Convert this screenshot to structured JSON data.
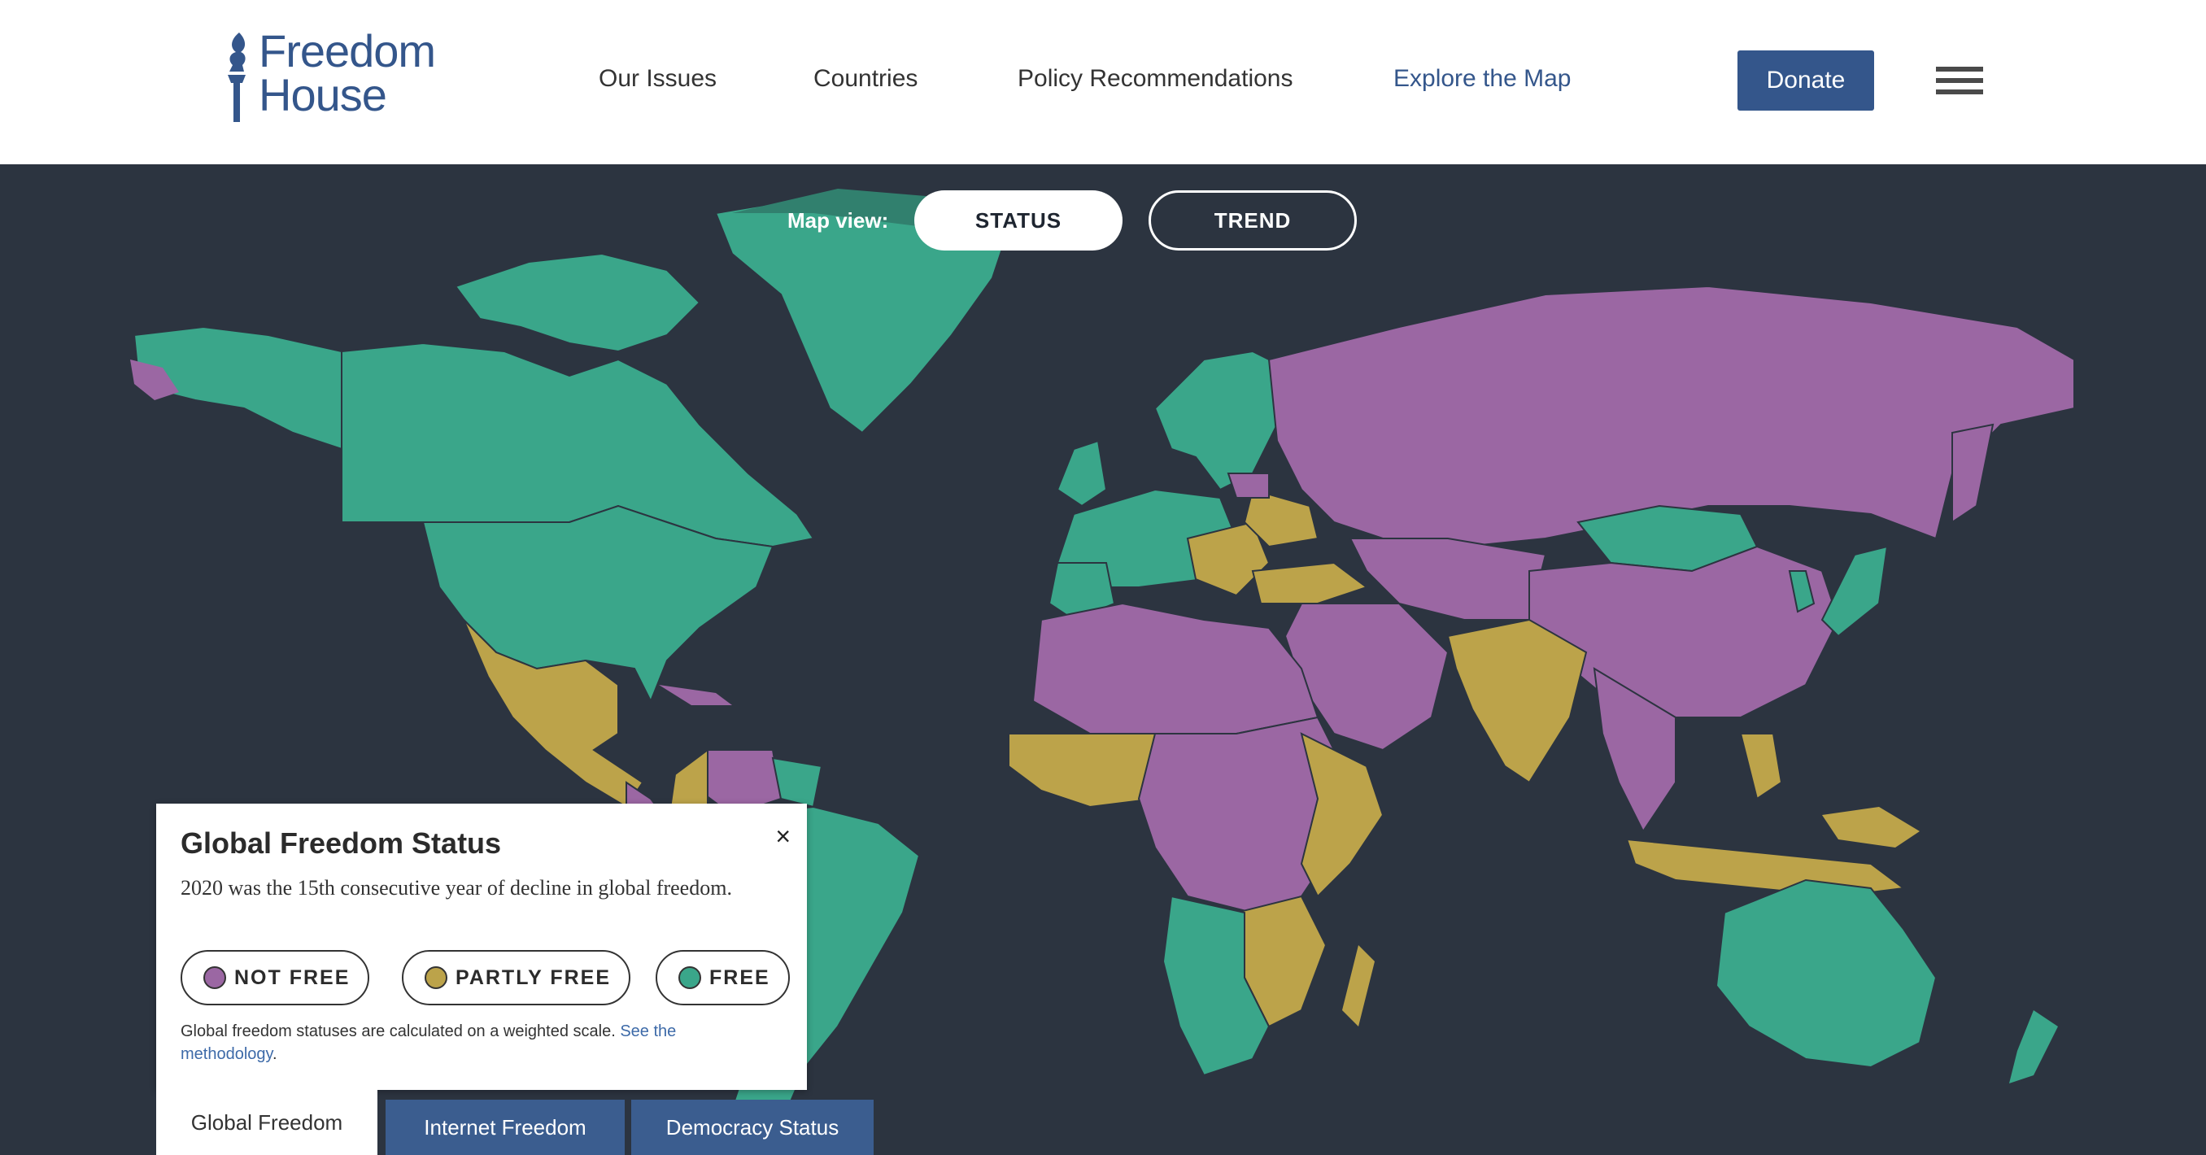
{
  "brand": {
    "logo_line1": "Freedom",
    "logo_line2": "House",
    "logo_color": "#34568b"
  },
  "nav": {
    "items": [
      "Our Issues",
      "Countries",
      "Policy Recommendations",
      "Explore the Map"
    ],
    "active": "Explore the Map",
    "donate_label": "Donate"
  },
  "map": {
    "view_label": "Map view:",
    "toggle_status": "STATUS",
    "toggle_trend": "TREND",
    "selected_view": "STATUS",
    "colors": {
      "not_free": "#9b67a3",
      "partly_free": "#bca34a",
      "free": "#3aa68a",
      "ocean": "#2c3440"
    }
  },
  "legend": {
    "title": "Global Freedom Status",
    "description": "2020 was the 15th consecutive year of decline in global freedom.",
    "close_label": "×",
    "categories": [
      {
        "label": "NOT FREE",
        "color": "#9b67a3"
      },
      {
        "label": "PARTLY FREE",
        "color": "#bca34a"
      },
      {
        "label": "FREE",
        "color": "#3aa68a"
      }
    ],
    "note_text": "Global freedom statuses are calculated on a weighted scale. ",
    "note_link": "See the methodology",
    "note_end": "."
  },
  "tabs": {
    "global": "Global Freedom",
    "internet": "Internet Freedom",
    "democracy": "Democracy Status",
    "active": "Global Freedom"
  }
}
